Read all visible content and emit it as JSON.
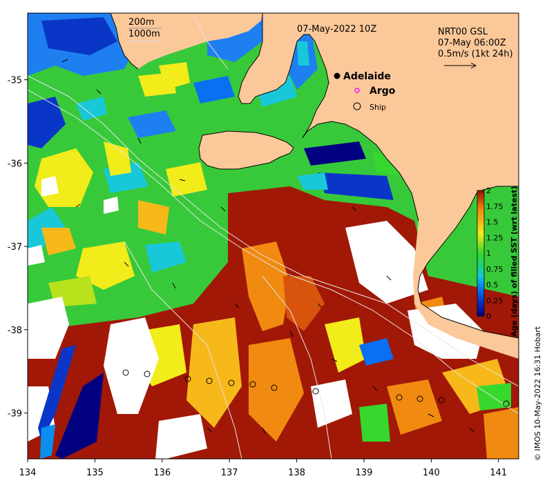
{
  "map": {
    "title": "07-May-2022 10Z",
    "current_label_lines": [
      "NRT00 GSL",
      "07-May 06:00Z",
      "0.5m/s (1kt 24h)"
    ],
    "depth_labels": [
      "200m",
      "1000m"
    ],
    "copyright": "© IMOS 10-May-2022 16:31 Hobart",
    "x_ticks": [
      "134",
      "135",
      "136",
      "137",
      "138",
      "139",
      "140",
      "141"
    ],
    "y_ticks": [
      "-35",
      "-36",
      "-37",
      "-38",
      "-39"
    ],
    "x_range": [
      134,
      141.3
    ],
    "y_range": [
      -39.55,
      -34.2
    ],
    "legend": [
      {
        "label": "Adelaide",
        "marker": "filled-circle",
        "color": "#000000"
      },
      {
        "label": "Argo",
        "marker": "open-circle",
        "color": "#ff00ff"
      },
      {
        "label": "Ship",
        "marker": "open-circle",
        "color": "#000000"
      }
    ],
    "colorbar": {
      "title": "Age (days) of filled SST (wrt latest)",
      "ticks": [
        "2",
        "1.75",
        "1.5",
        "1.25",
        "1",
        "0.75",
        "0.5",
        "0.25",
        "0"
      ],
      "range": [
        0,
        2
      ]
    },
    "colors": {
      "land": "#fbc89a",
      "ocean_missing": "#ffffff"
    }
  }
}
